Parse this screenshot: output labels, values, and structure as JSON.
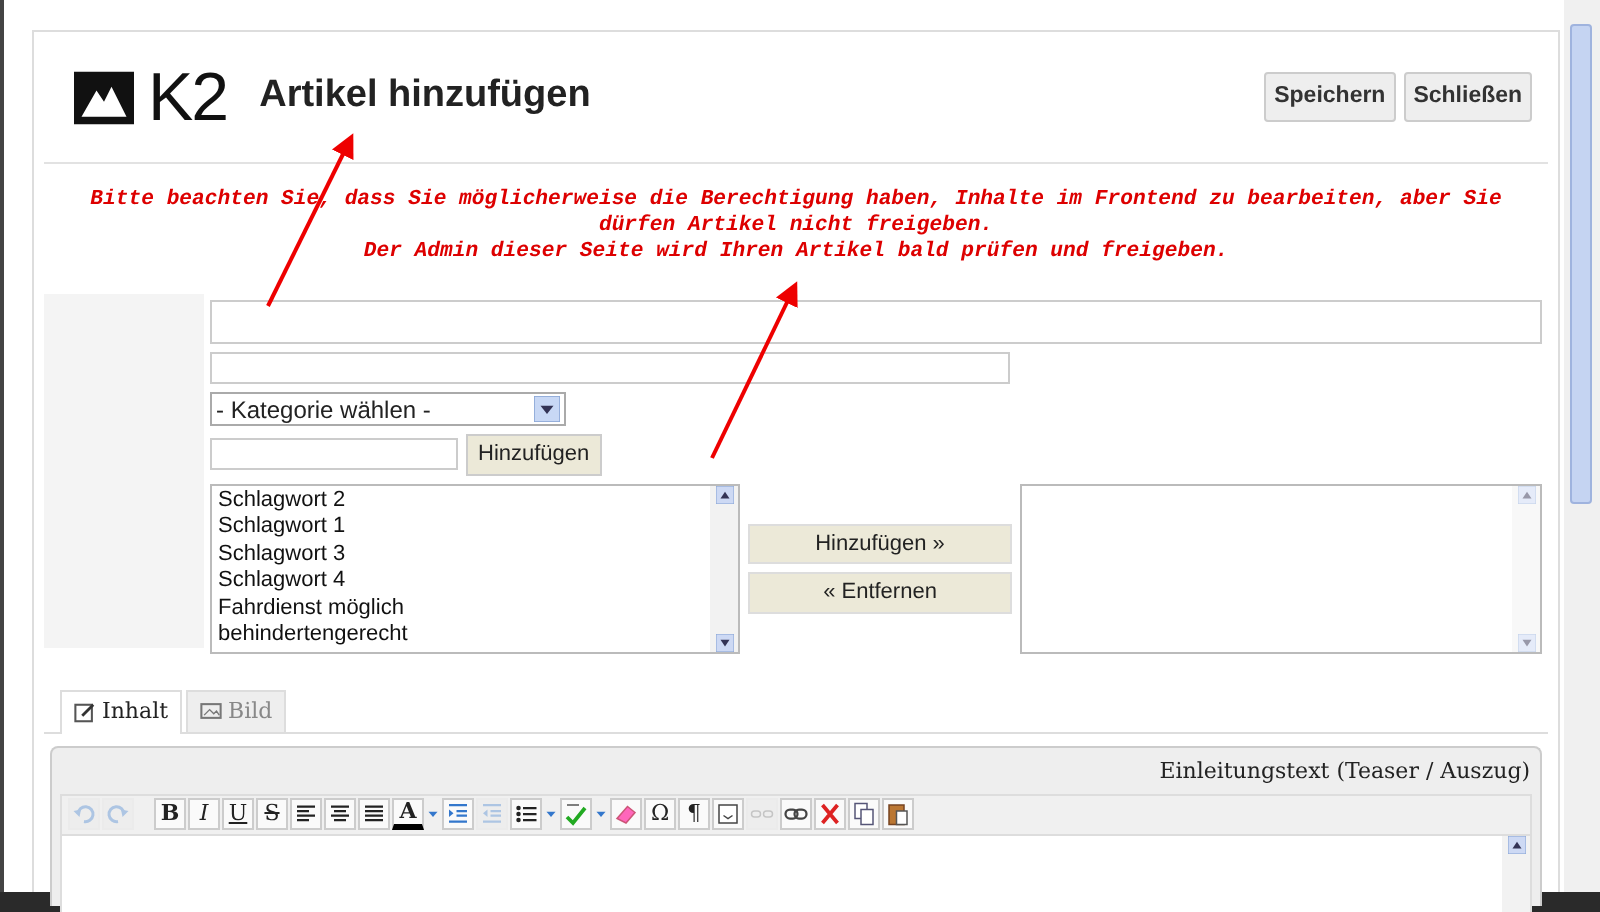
{
  "header": {
    "logo_text": "K2",
    "title": "Artikel hinzufügen",
    "buttons": [
      "Speichern",
      "Schließen"
    ]
  },
  "notice": [
    "Bitte beachten Sie, dass Sie möglicherweise die Berechtigung haben, Inhalte im Frontend zu bearbeiten, aber Sie dürfen Artikel nicht freigeben.",
    "Der Admin dieser Seite wird Ihren Artikel bald prüfen und freigeben."
  ],
  "form": {
    "category_select": {
      "value": "- Kategorie wählen -"
    },
    "tag_add_button": "Hinzufügen",
    "tags_available": [
      "Schlagwort 2",
      "Schlagwort 1",
      "Schlagwort 3",
      "Schlagwort 4",
      "Fahrdienst möglich",
      "behindertengerecht"
    ],
    "transfer_buttons": [
      "Hinzufügen »",
      "« Entfernen"
    ]
  },
  "tabs": [
    {
      "label": "Inhalt",
      "selected": true,
      "kind": "edit"
    },
    {
      "label": "Bild",
      "selected": false,
      "kind": "image"
    }
  ],
  "editor": {
    "heading": "Einleitungstext (Teaser / Auszug)",
    "toolbar": [
      {
        "kind": "undo",
        "disabled": true
      },
      {
        "kind": "redo",
        "disabled": true
      },
      {
        "kind": "sep"
      },
      {
        "kind": "bold",
        "label": "B",
        "disabled": false
      },
      {
        "kind": "italic",
        "label": "I",
        "disabled": false
      },
      {
        "kind": "underline",
        "label": "U",
        "disabled": false
      },
      {
        "kind": "strike",
        "label": "S",
        "disabled": false
      },
      {
        "kind": "align-left",
        "disabled": false
      },
      {
        "kind": "align-center",
        "disabled": false
      },
      {
        "kind": "justify",
        "disabled": false
      },
      {
        "kind": "textcolor",
        "label": "A",
        "disabled": false
      },
      {
        "kind": "dropdown"
      },
      {
        "kind": "indent",
        "disabled": false
      },
      {
        "kind": "outdent",
        "disabled": true
      },
      {
        "kind": "list",
        "disabled": false
      },
      {
        "kind": "dropdown"
      },
      {
        "kind": "spellcheck",
        "disabled": false
      },
      {
        "kind": "dropdown"
      },
      {
        "kind": "eraser",
        "disabled": false
      },
      {
        "kind": "symbol",
        "label": "Ω",
        "disabled": false
      },
      {
        "kind": "symbol",
        "label": "¶",
        "disabled": false
      },
      {
        "kind": "template",
        "disabled": false
      },
      {
        "kind": "unlink",
        "disabled": true
      },
      {
        "kind": "link",
        "disabled": false
      },
      {
        "kind": "cut",
        "disabled": false
      },
      {
        "kind": "copy",
        "disabled": false
      },
      {
        "kind": "paste",
        "disabled": false
      }
    ]
  }
}
